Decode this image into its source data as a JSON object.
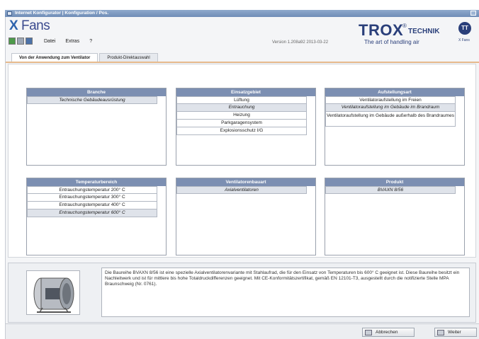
{
  "window": {
    "title": "Internet Konfigurator | Konfiguration / Pos."
  },
  "app": {
    "brand_x": "X",
    "brand_name": "Fans",
    "version": "Version 1.208a92  2013-03-22"
  },
  "menu": [
    "Datei",
    "Extras",
    "?"
  ],
  "logo": {
    "word": "TROX",
    "reg": "®",
    "technik": "TECHNIK",
    "tagline": "The art of handling air",
    "badge": "TT",
    "small": "X Fans"
  },
  "tabs": [
    "Von der Anwendung zum Ventilator",
    "Produkt-Direktauswahl"
  ],
  "panels": {
    "branche": {
      "title": "Branche",
      "items": [
        "Technische Gebäudeausrüstung"
      ],
      "selected": 0
    },
    "einsatzgebiet": {
      "title": "Einsatzgebiet",
      "items": [
        "Lüftung",
        "Entrauchung",
        "Heizung",
        "Parkgaragensystem",
        "Explosionsschutz I/G"
      ],
      "selected": 1
    },
    "aufstellungsart": {
      "title": "Aufstellungsart",
      "items": [
        "Ventilatoraufstellung im Freien",
        "Ventilatoraufstellung im Gebäude im Brandraum",
        "Ventilatoraufstellung im Gebäude außerhalb des Brandraumes"
      ],
      "selected": 1
    },
    "temperaturbereich": {
      "title": "Temperaturbereich",
      "items": [
        "Entrauchungstemperatur 200° C",
        "Entrauchungstemperatur 300° C",
        "Entrauchungstemperatur 400° C",
        "Entrauchungstemperatur 600° C"
      ],
      "selected": 3
    },
    "bauart": {
      "title": "Ventilatorenbauart",
      "items": [
        "Axialventilatoren"
      ],
      "selected": 0
    },
    "produkt": {
      "title": "Produkt",
      "items": [
        "BVAXN 8/56"
      ],
      "selected": 0
    }
  },
  "description": "Die Baureihe BVAXN 8/56 ist eine spezielle Axialventilatorenvariante mit Stahlaufrad, die für den Einsatz von Temperaturen bis 600° C geeignet ist. Diese Baureihe besitzt ein Nachleitwerk und ist für mittlere bis hohe Totaldruckdifferenzen geeignet. Mit CE-Konformitätszertifikat, gemäß EN 12101-T3, ausgestellt durch die notifizierte Stelle MPA Braunschweig (Nr. 0761).",
  "buttons": {
    "cancel": "Abbrechen",
    "next": "Weiter"
  }
}
